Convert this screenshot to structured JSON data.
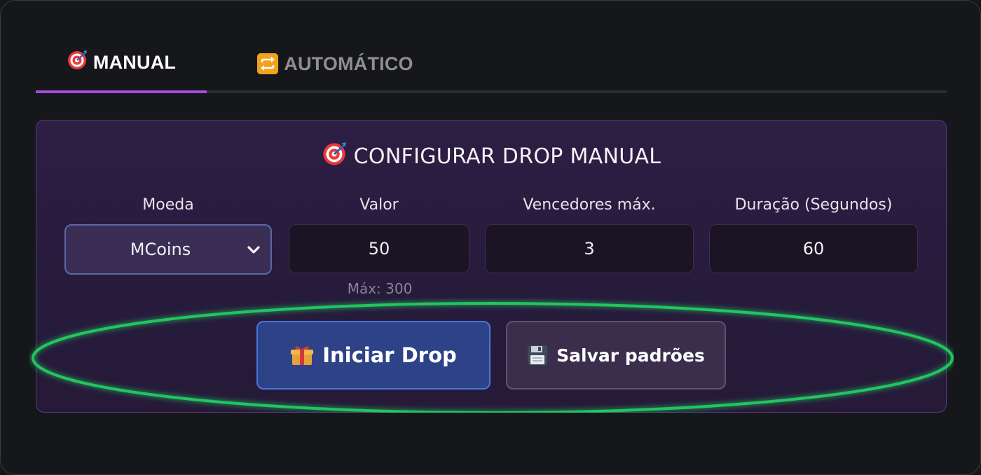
{
  "tabs": [
    {
      "icon": "target-icon",
      "label": "MANUAL",
      "active": true
    },
    {
      "icon": "repeat-icon",
      "label": "AUTOMÁTICO",
      "active": false
    }
  ],
  "card": {
    "title": "CONFIGURAR DROP MANUAL",
    "title_icon": "target-icon",
    "fields": {
      "currency": {
        "label": "Moeda",
        "value": "MCoins"
      },
      "amount": {
        "label": "Valor",
        "value": "50",
        "hint": "Máx: 300"
      },
      "max_winners": {
        "label": "Vencedores máx.",
        "value": "3"
      },
      "duration": {
        "label": "Duração (Segundos)",
        "value": "60"
      }
    },
    "buttons": {
      "start": {
        "label": "Iniciar Drop",
        "icon": "gift-icon"
      },
      "save": {
        "label": "Salvar padrões",
        "icon": "floppy-disk-icon"
      }
    }
  },
  "colors": {
    "accent_tab": "#a24ce0",
    "start_button": "#2e4288",
    "highlight": "#22c55e"
  }
}
